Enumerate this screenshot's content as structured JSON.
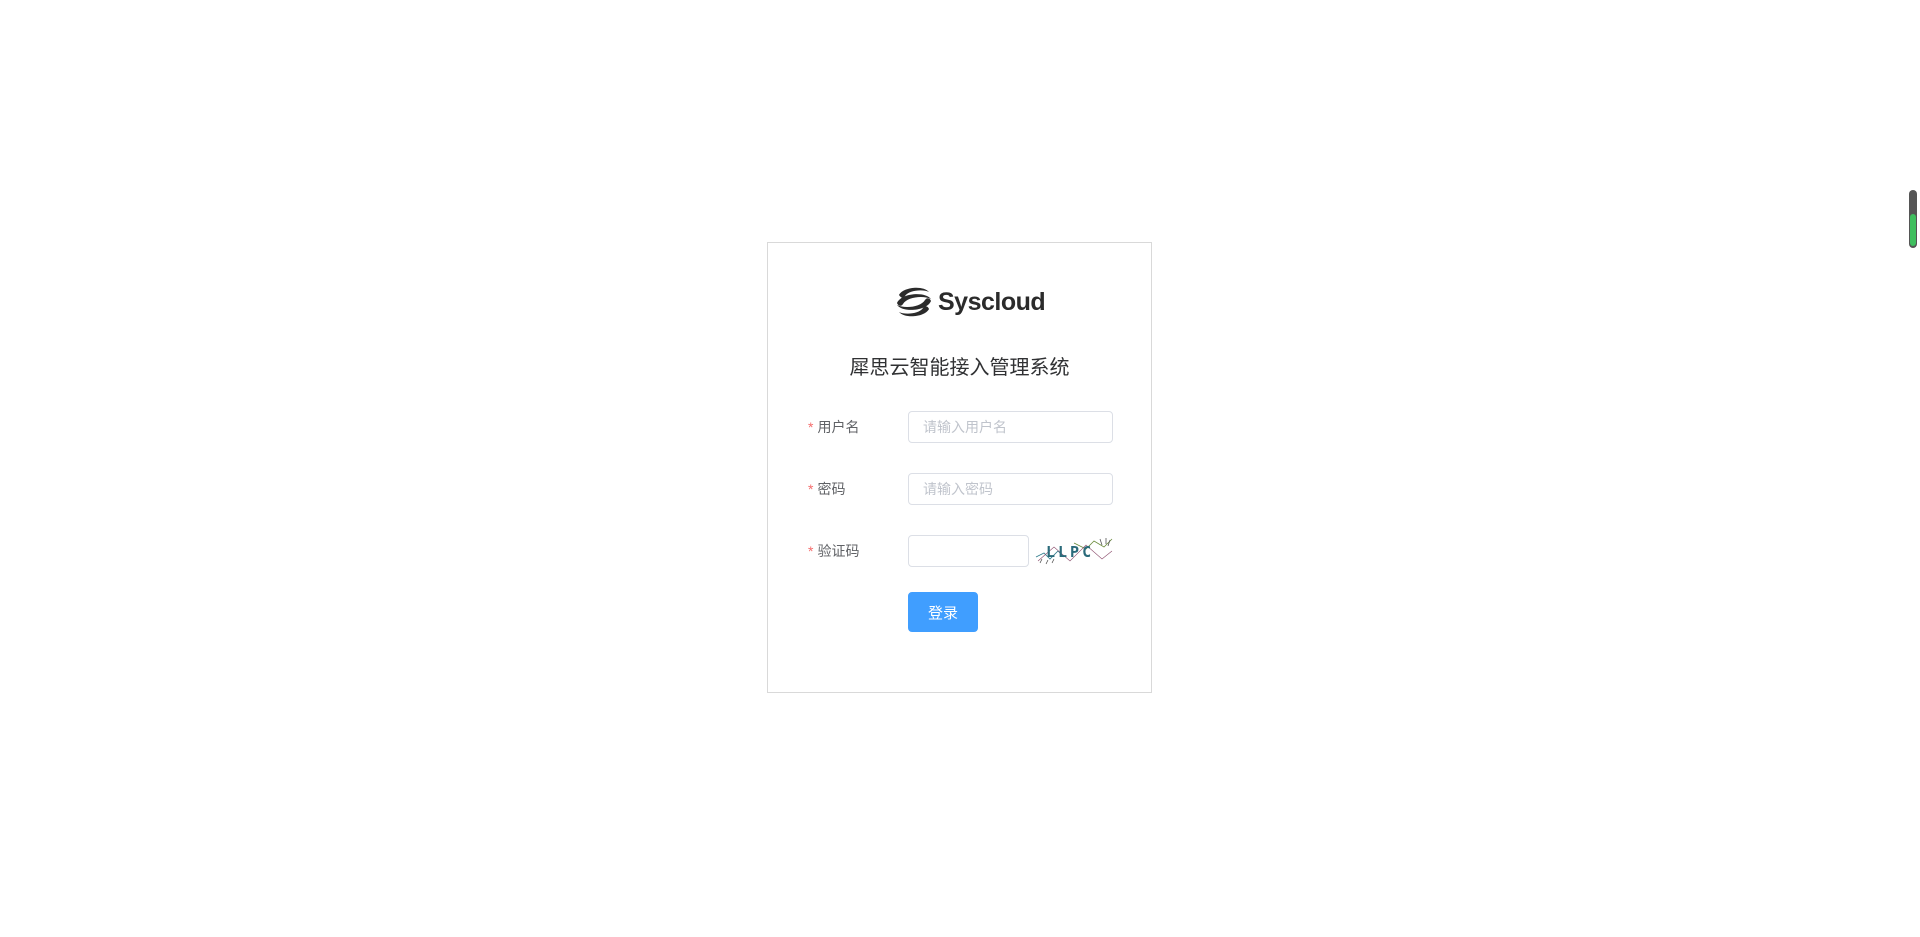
{
  "login": {
    "logo_text": "Syscloud",
    "system_title": "犀思云智能接入管理系统",
    "username": {
      "required_mark": "*",
      "label": "用户名",
      "value": "",
      "placeholder": "请输入用户名"
    },
    "password": {
      "required_mark": "*",
      "label": "密码",
      "value": "",
      "placeholder": "请输入密码"
    },
    "captcha": {
      "required_mark": "*",
      "label": "验证码",
      "value": "",
      "image_text": "LLPC"
    },
    "submit_label": "登录"
  },
  "scroll_indicator": {
    "level": 0.55,
    "fill_color": "#3fbf5f"
  },
  "colors": {
    "accent": "#409eff",
    "required": "#f56c6c",
    "border": "#dcdfe6"
  }
}
